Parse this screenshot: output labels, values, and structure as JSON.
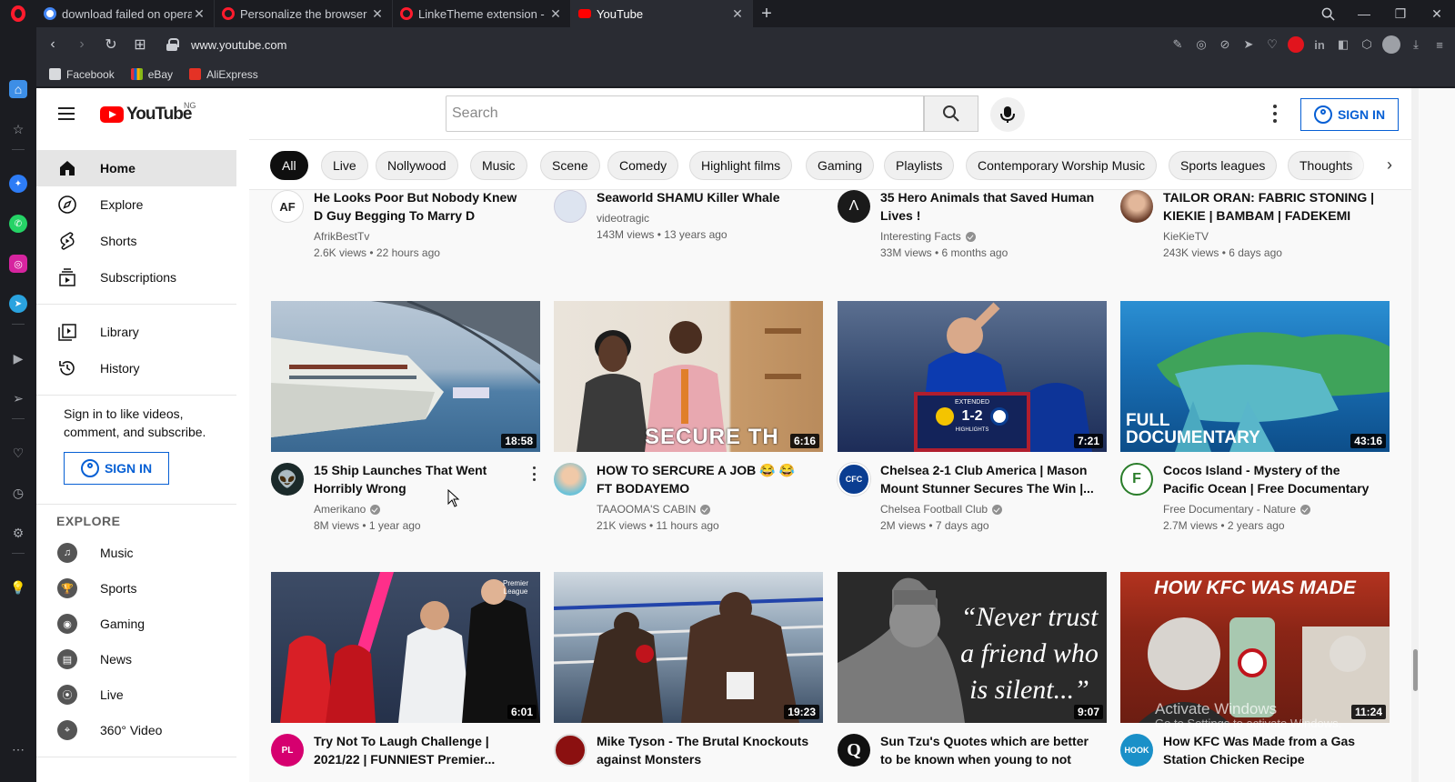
{
  "browser": {
    "tabs": [
      {
        "title": "download failed on opera",
        "favicon": "google-icon"
      },
      {
        "title": "Personalize the browser - O",
        "favicon": "opera-icon"
      },
      {
        "title": "LinkeTheme extension - Op",
        "favicon": "opera-icon"
      },
      {
        "title": "YouTube",
        "favicon": "youtube-icon",
        "active": true
      }
    ],
    "new_tab": "+",
    "url": "www.youtube.com",
    "bookmarks": [
      {
        "label": "Facebook",
        "icon": "page-icon"
      },
      {
        "label": "eBay",
        "icon": "ebay-icon"
      },
      {
        "label": "AliExpress",
        "icon": "aliexpress-icon"
      }
    ],
    "accent": "#ff1b2d"
  },
  "header": {
    "logo_text": "YouTube",
    "region": "NG",
    "search_placeholder": "Search",
    "signin_label": "SIGN IN",
    "accent_blue": "#065fd4"
  },
  "sidebar": {
    "main": [
      {
        "label": "Home",
        "icon": "home-icon",
        "active": true
      },
      {
        "label": "Explore",
        "icon": "compass-icon"
      },
      {
        "label": "Shorts",
        "icon": "shorts-icon"
      },
      {
        "label": "Subscriptions",
        "icon": "subscriptions-icon"
      }
    ],
    "library": [
      {
        "label": "Library",
        "icon": "library-icon"
      },
      {
        "label": "History",
        "icon": "history-icon"
      }
    ],
    "signin_prompt": "Sign in to like videos, comment, and subscribe.",
    "signin_label": "SIGN IN",
    "explore_heading": "EXPLORE",
    "explore": [
      {
        "label": "Music",
        "icon": "music-icon"
      },
      {
        "label": "Sports",
        "icon": "trophy-icon"
      },
      {
        "label": "Gaming",
        "icon": "gamepad-icon"
      },
      {
        "label": "News",
        "icon": "news-icon"
      },
      {
        "label": "Live",
        "icon": "live-icon"
      },
      {
        "label": "360° Video",
        "icon": "vr-icon"
      }
    ]
  },
  "chips": [
    "All",
    "Live",
    "Nollywood",
    "Music",
    "Scene",
    "Comedy",
    "Highlight films",
    "Gaming",
    "Playlists",
    "Contemporary Worship Music",
    "Sports leagues",
    "Thoughts"
  ],
  "videos": [
    {
      "title": "He Looks Poor But Nobody Knew D Guy Begging To Marry D Princess I...",
      "channel": "AfrikBestTv",
      "verified": false,
      "meta": "2.6K views • 22 hours ago",
      "avatar_color": "#ffffff",
      "avatar_text": "AF"
    },
    {
      "title": "Seaworld SHAMU Killer Whale Show",
      "channel": "videotragic",
      "verified": false,
      "meta": "143M views • 13 years ago",
      "avatar_color": "#dde4f0",
      "avatar_text": ""
    },
    {
      "title": "35 Hero Animals that Saved Human Lives !",
      "channel": "Interesting Facts",
      "verified": true,
      "meta": "33M views • 6 months ago",
      "avatar_color": "#1a1a1a",
      "avatar_text": "Λ"
    },
    {
      "title": "TAILOR ORAN: FABRIC STONING | KIEKIE | BAMBAM | FADEKEMI",
      "channel": "KieKieTV",
      "verified": false,
      "meta": "243K views • 6 days ago",
      "avatar_color": "#b97b5e",
      "avatar_text": ""
    },
    {
      "title": "15 Ship Launches That Went Horribly Wrong",
      "channel": "Amerikano",
      "verified": true,
      "meta": "8M views • 1 year ago",
      "duration": "18:58",
      "avatar_color": "#1b2a2a",
      "avatar_text": "👽"
    },
    {
      "title": "HOW TO SERCURE A JOB 😂 😂 FT BODAYEMO",
      "channel": "TAAOOMA'S CABIN",
      "verified": true,
      "meta": "21K views • 11 hours ago",
      "duration": "6:16",
      "avatar_color": "#6cc2d8",
      "avatar_text": ""
    },
    {
      "title": "Chelsea 2-1 Club America | Mason Mount Stunner Secures The Win |...",
      "channel": "Chelsea Football Club",
      "verified": true,
      "meta": "2M views • 7 days ago",
      "duration": "7:21",
      "avatar_color": "#0a3d91",
      "avatar_text": "CFC"
    },
    {
      "title": "Cocos Island - Mystery of the Pacific Ocean | Free Documentary Nature",
      "channel": "Free Documentary - Nature",
      "verified": true,
      "meta": "2.7M views • 2 years ago",
      "duration": "43:16",
      "avatar_color": "#ffffff",
      "avatar_text": "F"
    },
    {
      "title": "Try Not To Laugh Challenge | 2021/22 | FUNNIEST Premier...",
      "channel": "",
      "verified": false,
      "meta": "",
      "duration": "6:01",
      "avatar_color": "#d6006f",
      "avatar_text": "PL"
    },
    {
      "title": "Mike Tyson - The Brutal Knockouts against Monsters",
      "channel": "",
      "verified": false,
      "meta": "",
      "duration": "19:23",
      "avatar_color": "#8b1010",
      "avatar_text": ""
    },
    {
      "title": "Sun Tzu's Quotes which are better to be known when young to not Regre...",
      "channel": "",
      "verified": false,
      "meta": "",
      "duration": "9:07",
      "avatar_color": "#111111",
      "avatar_text": "Q"
    },
    {
      "title": "How KFC Was Made from a Gas Station Chicken Recipe",
      "channel": "",
      "verified": false,
      "meta": "",
      "duration": "11:24",
      "avatar_color": "#1a90c8",
      "avatar_text": "HOOK"
    }
  ],
  "thumb_text": {
    "job": "SECURE TH",
    "chelsea_badge": "EXTENDED",
    "chelsea_score": "1-2",
    "chelsea_sub": "HIGHLIGHTS",
    "cocos": "FULL DOCUMENTARY",
    "pl": "Premier League",
    "suntzu": "“Never trust a friend who is silent...”",
    "kfc": "HOW KFC WAS MADE"
  },
  "watermark": {
    "line1": "Activate Windows",
    "line2": "Go to Settings to activate Windows."
  }
}
